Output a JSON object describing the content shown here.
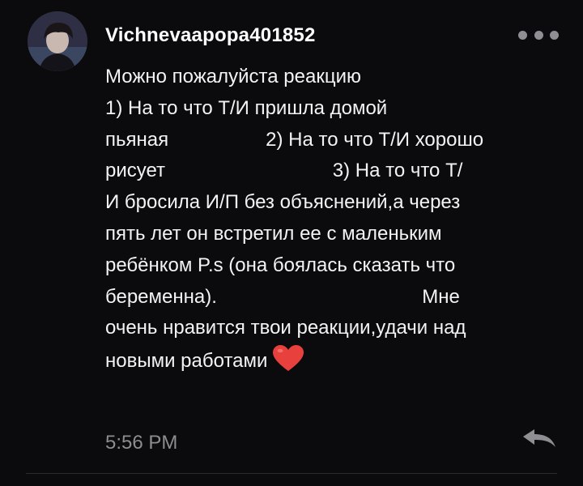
{
  "comment": {
    "username": "Vichnevaapopa401852",
    "lines": [
      "Можно пожалуйста реакцию",
      "1) На то что Т/И пришла домой",
      "пьяная                  2) На то что Т/И хорошо",
      "рисует                               3) На то что Т/",
      "И бросила И/П без объяснений,а через",
      "пять лет он встретил ее с маленьким",
      "ребёнком P.s (она боялась сказать что",
      "беременна).                                      Мне",
      "очень нравится твои реакции,удачи над",
      "новыми работами"
    ],
    "emoji": "heart",
    "timestamp": "5:56 PM"
  },
  "icons": {
    "more": "more-horizontal-icon",
    "reply": "reply-arrow-icon",
    "heart": "red-heart-icon"
  },
  "colors": {
    "background": "#0b0a0c",
    "text": "#f3f3f3",
    "muted": "#8d8d90",
    "heart": "#e8403c"
  }
}
